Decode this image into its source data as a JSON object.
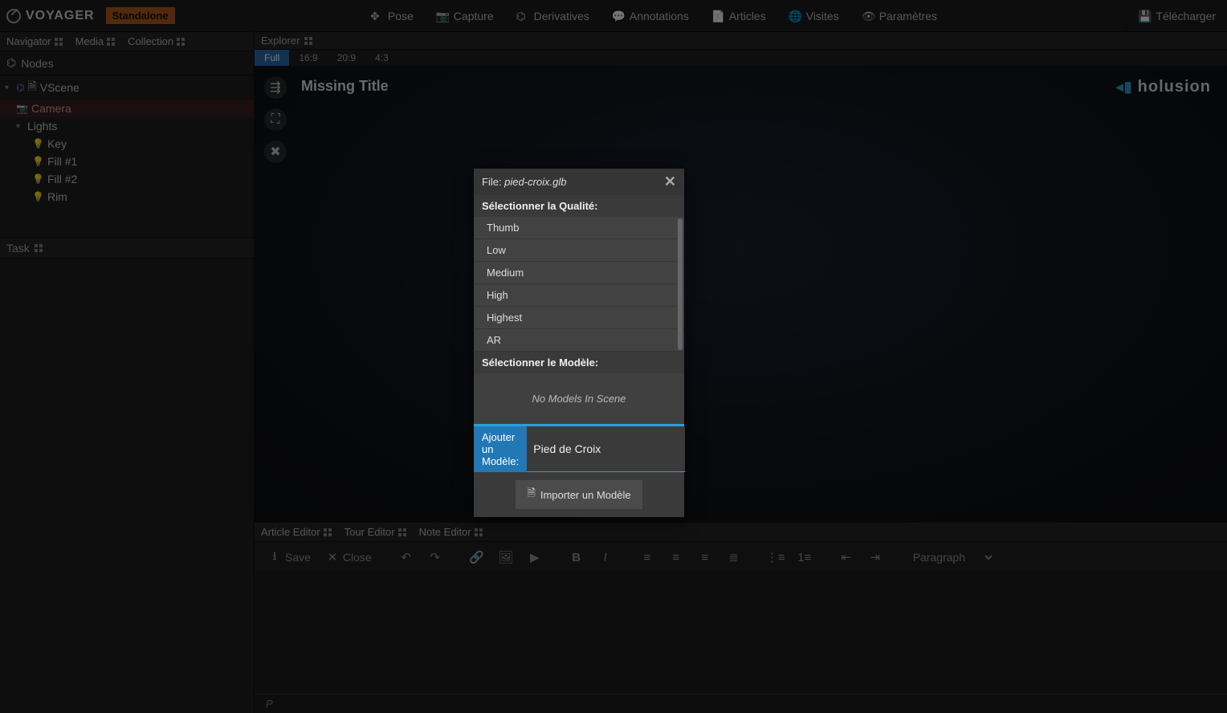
{
  "app": {
    "name": "VOYAGER",
    "badge": "Standalone",
    "brand": "holusion"
  },
  "toolbar": {
    "pose": "Pose",
    "capture": "Capture",
    "derivatives": "Derivatives",
    "annotations": "Annotations",
    "articles": "Articles",
    "visites": "Visites",
    "parametres": "Paramètres",
    "telecharger": "Télécharger"
  },
  "leftTabs": {
    "navigator": "Navigator",
    "media": "Media",
    "collection": "Collection"
  },
  "nodesHeader": "Nodes",
  "tree": {
    "scene": "VScene",
    "camera": "Camera",
    "lights": "Lights",
    "key": "Key",
    "fill1": "Fill #1",
    "fill2": "Fill #2",
    "rim": "Rim"
  },
  "taskHeader": "Task",
  "explorerHeader": "Explorer",
  "aspects": {
    "full": "Full",
    "r169": "16:9",
    "r209": "20:9",
    "r43": "4:3"
  },
  "viewport": {
    "title": "Missing Title"
  },
  "bottomTabs": {
    "article": "Article Editor",
    "tour": "Tour Editor",
    "note": "Note Editor"
  },
  "editor": {
    "save": "Save",
    "close": "Close",
    "paragraph": "Paragraph",
    "statusPath": "P"
  },
  "modal": {
    "filePrefix": "File: ",
    "fileName": "pied-croix.glb",
    "selectQuality": "Sélectionner la Qualité:",
    "qualities": [
      "Thumb",
      "Low",
      "Medium",
      "High",
      "Highest",
      "AR"
    ],
    "selectModel": "Sélectionner le Modèle:",
    "noModels": "No Models In Scene",
    "addModelLabel": "Ajouter un Modèle:",
    "addModelValue": "Pied de Croix",
    "importBtn": "Importer un Modèle"
  }
}
